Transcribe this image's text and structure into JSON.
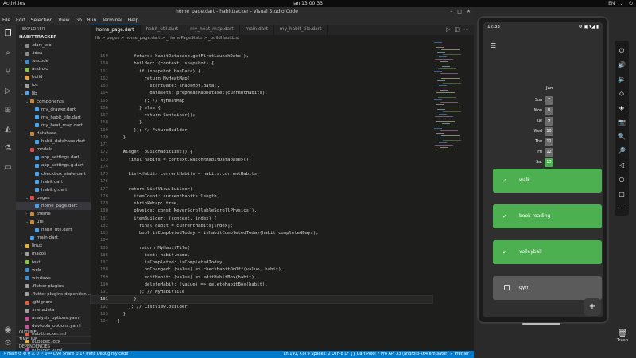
{
  "topbar": {
    "activities": "Activities",
    "clock": "Jan 13  00:33",
    "tray": [
      "EN",
      "♪",
      "⏻"
    ]
  },
  "vscode": {
    "window_title": "home_page.dart - habittracker - Visual Studio Code",
    "menu": [
      "File",
      "Edit",
      "Selection",
      "View",
      "Go",
      "Run",
      "Terminal",
      "Help"
    ],
    "explorer_header": "EXPLORER",
    "project": "HABITTRACKER",
    "tree": [
      {
        "label": ".dart_tool",
        "indent": 1,
        "type": "folder",
        "color": "#8a8a8a"
      },
      {
        "label": ".idea",
        "indent": 1,
        "type": "folder",
        "color": "#8a8a8a"
      },
      {
        "label": ".vscode",
        "indent": 1,
        "type": "folder",
        "color": "#3d8fd1"
      },
      {
        "label": "android",
        "indent": 1,
        "type": "folder",
        "color": "#8bc34a"
      },
      {
        "label": "build",
        "indent": 1,
        "type": "folder",
        "color": "#e8a33b"
      },
      {
        "label": "ios",
        "indent": 1,
        "type": "folder",
        "color": "#9e9e9e"
      },
      {
        "label": "lib",
        "indent": 1,
        "type": "folder-open",
        "color": "#5aa0e6"
      },
      {
        "label": "components",
        "indent": 2,
        "type": "folder-open",
        "color": "#c78a3b"
      },
      {
        "label": "my_drawer.dart",
        "indent": 3,
        "type": "file",
        "color": "#42a5f5"
      },
      {
        "label": "my_habit_tile.dart",
        "indent": 3,
        "type": "file",
        "color": "#42a5f5"
      },
      {
        "label": "my_heat_map.dart",
        "indent": 3,
        "type": "file",
        "color": "#42a5f5"
      },
      {
        "label": "database",
        "indent": 2,
        "type": "folder-open",
        "color": "#c78a3b"
      },
      {
        "label": "habit_database.dart",
        "indent": 3,
        "type": "file",
        "color": "#42a5f5"
      },
      {
        "label": "models",
        "indent": 2,
        "type": "folder-open",
        "color": "#e04c4c"
      },
      {
        "label": "app_settings.dart",
        "indent": 3,
        "type": "file",
        "color": "#42a5f5"
      },
      {
        "label": "app_settings.g.dart",
        "indent": 3,
        "type": "file",
        "color": "#42a5f5"
      },
      {
        "label": "checkbox_state.dart",
        "indent": 3,
        "type": "file",
        "color": "#42a5f5"
      },
      {
        "label": "habit.dart",
        "indent": 3,
        "type": "file",
        "color": "#42a5f5"
      },
      {
        "label": "habit.g.dart",
        "indent": 3,
        "type": "file",
        "color": "#42a5f5"
      },
      {
        "label": "pages",
        "indent": 2,
        "type": "folder-open",
        "color": "#e04c4c"
      },
      {
        "label": "home_page.dart",
        "indent": 3,
        "type": "file",
        "color": "#42a5f5",
        "selected": true
      },
      {
        "label": "theme",
        "indent": 2,
        "type": "folder",
        "color": "#c78a3b"
      },
      {
        "label": "util",
        "indent": 2,
        "type": "folder-open",
        "color": "#c78a3b"
      },
      {
        "label": "habit_util.dart",
        "indent": 3,
        "type": "file",
        "color": "#42a5f5"
      },
      {
        "label": "main.dart",
        "indent": 2,
        "type": "file",
        "color": "#42a5f5"
      },
      {
        "label": "linux",
        "indent": 1,
        "type": "folder",
        "color": "#e6b13b"
      },
      {
        "label": "macos",
        "indent": 1,
        "type": "folder",
        "color": "#9e9e9e"
      },
      {
        "label": "test",
        "indent": 1,
        "type": "folder",
        "color": "#8bc34a"
      },
      {
        "label": "web",
        "indent": 1,
        "type": "folder",
        "color": "#3d8fd1"
      },
      {
        "label": "windows",
        "indent": 1,
        "type": "folder",
        "color": "#3d8fd1"
      },
      {
        "label": ".flutter-plugins",
        "indent": 1,
        "type": "file",
        "color": "#9e9e9e"
      },
      {
        "label": ".flutter-plugins-dependen...",
        "indent": 1,
        "type": "file",
        "color": "#9e9e9e"
      },
      {
        "label": ".gitignore",
        "indent": 1,
        "type": "file",
        "color": "#e05d44"
      },
      {
        "label": ".metadata",
        "indent": 1,
        "type": "file",
        "color": "#9e9e9e"
      },
      {
        "label": "analysis_options.yaml",
        "indent": 1,
        "type": "file",
        "color": "#c94f9a"
      },
      {
        "label": "devtools_options.yaml",
        "indent": 1,
        "type": "file",
        "color": "#c94f9a"
      },
      {
        "label": "habittracker.iml",
        "indent": 1,
        "type": "file",
        "color": "#e05d44"
      },
      {
        "label": "pubspec.lock",
        "indent": 1,
        "type": "file",
        "color": "#e6b13b"
      },
      {
        "label": "pubspec.yaml",
        "indent": 1,
        "type": "file",
        "color": "#c94f9a"
      }
    ],
    "outline": "OUTLINE",
    "timeline": "TIMELINE",
    "dependencies": "DEPENDENCIES",
    "tabs": [
      {
        "label": "home_page.dart",
        "active": true
      },
      {
        "label": "habit_util.dart",
        "active": false
      },
      {
        "label": "my_heat_map.dart",
        "active": false
      },
      {
        "label": "main.dart",
        "active": false
      },
      {
        "label": "my_habit_tile.dart",
        "active": false
      }
    ],
    "breadcrumb": "lib > pages > home_page.dart > _HomePageState > _buildHabitList",
    "code": [
      {
        "n": "159",
        "t": "      future: habitDatabase.getFirstLaunchDate(),"
      },
      {
        "n": "160",
        "t": "      builder: (context, snapshot) {"
      },
      {
        "n": "161",
        "t": "        if (snapshot.hasData) {"
      },
      {
        "n": "162",
        "t": "          return MyHeatMap("
      },
      {
        "n": "163",
        "t": "            startDate: snapshot.data!,"
      },
      {
        "n": "164",
        "t": "            datasets: prepHeatMapDataset(currentHabits),"
      },
      {
        "n": "165",
        "t": "          ); // MyHeatMap"
      },
      {
        "n": "166",
        "t": "        } else {"
      },
      {
        "n": "167",
        "t": "          return Container();"
      },
      {
        "n": "168",
        "t": "        }"
      },
      {
        "n": "169",
        "t": "      }); // FutureBuilder"
      },
      {
        "n": "170",
        "t": "  }"
      },
      {
        "n": "171",
        "t": ""
      },
      {
        "n": "172",
        "t": "  Widget _buildHabitList() {"
      },
      {
        "n": "173",
        "t": "    final habits = context.watch<HabitDatabase>();"
      },
      {
        "n": "174",
        "t": ""
      },
      {
        "n": "175",
        "t": "    List<Habit> currentHabits = habits.currentHabits;"
      },
      {
        "n": "176",
        "t": ""
      },
      {
        "n": "177",
        "t": "    return ListView.builder("
      },
      {
        "n": "178",
        "t": "      itemCount: currentHabits.length,"
      },
      {
        "n": "179",
        "t": "      shrinkWrap: true,"
      },
      {
        "n": "180",
        "t": "      physics: const NeverScrollableScrollPhysics(),"
      },
      {
        "n": "181",
        "t": "      itemBuilder: (context, index) {"
      },
      {
        "n": "182",
        "t": "        final habit = currentHabits[index];"
      },
      {
        "n": "183",
        "t": "        bool isCompletedToday = isHabitCompletedToday(habit.completedDays);"
      },
      {
        "n": "184",
        "t": ""
      },
      {
        "n": "185",
        "t": "        return MyHabitTile("
      },
      {
        "n": "186",
        "t": "          text: habit.name,"
      },
      {
        "n": "187",
        "t": "          isCompleted: isCompletedToday,"
      },
      {
        "n": "188",
        "t": "          onChanged: (value) => checkHabitOnOff(value, habit),"
      },
      {
        "n": "189",
        "t": "          editHabit: (value) => editHabitBox(habit),"
      },
      {
        "n": "190",
        "t": "          deleteHabit: (value) => deleteHabitBox(habit),"
      },
      {
        "n": "191",
        "t": "        ); // MyHabitTile"
      },
      {
        "n": "191",
        "t": "      },",
        "current": true
      },
      {
        "n": "192",
        "t": "    ); // ListView.builder"
      },
      {
        "n": "193",
        "t": "  }"
      },
      {
        "n": "194",
        "t": "}"
      }
    ],
    "status": {
      "left": "⚡ main ⟳   ⊗ 0 ⚠ 0   ⚐ 0   ⚯ Live Share   ⏱ 17 mins   Debug my code",
      "right": "Ln 191, Col 9   Spaces: 2   UTF-8   LF   {} Dart   Pixel 7 Pro API 33 (android-x64 emulator)   ✓ Prettier"
    }
  },
  "phone": {
    "time": "12:33",
    "status_icons": "⚙ ▣  ▾◢ ▮",
    "month": "Jan",
    "heatmap": [
      {
        "day": "Sun",
        "date": "7",
        "level": 0
      },
      {
        "day": "Mon",
        "date": "8",
        "level": 0
      },
      {
        "day": "Tue",
        "date": "9",
        "level": 0
      },
      {
        "day": "Wed",
        "date": "10",
        "level": 0
      },
      {
        "day": "Thu",
        "date": "11",
        "level": 0
      },
      {
        "day": "Fri",
        "date": "12",
        "level": 0
      },
      {
        "day": "Sat",
        "date": "13",
        "level": 1
      }
    ],
    "habits": [
      {
        "name": "walk",
        "done": true
      },
      {
        "name": "book reading",
        "done": true
      },
      {
        "name": "volleyball",
        "done": true
      },
      {
        "name": "gym",
        "done": false
      }
    ],
    "fab": "+",
    "colors": {
      "done": "#4caf50",
      "todo": "#5b5b5b",
      "today": "#4caf50"
    }
  },
  "emulator_tools": [
    "⏻",
    "🔊",
    "🔉",
    "◇",
    "◈",
    "📷",
    "🔍",
    "🔎",
    "◁",
    "○",
    "□",
    "⋯"
  ],
  "trash": "Trash"
}
